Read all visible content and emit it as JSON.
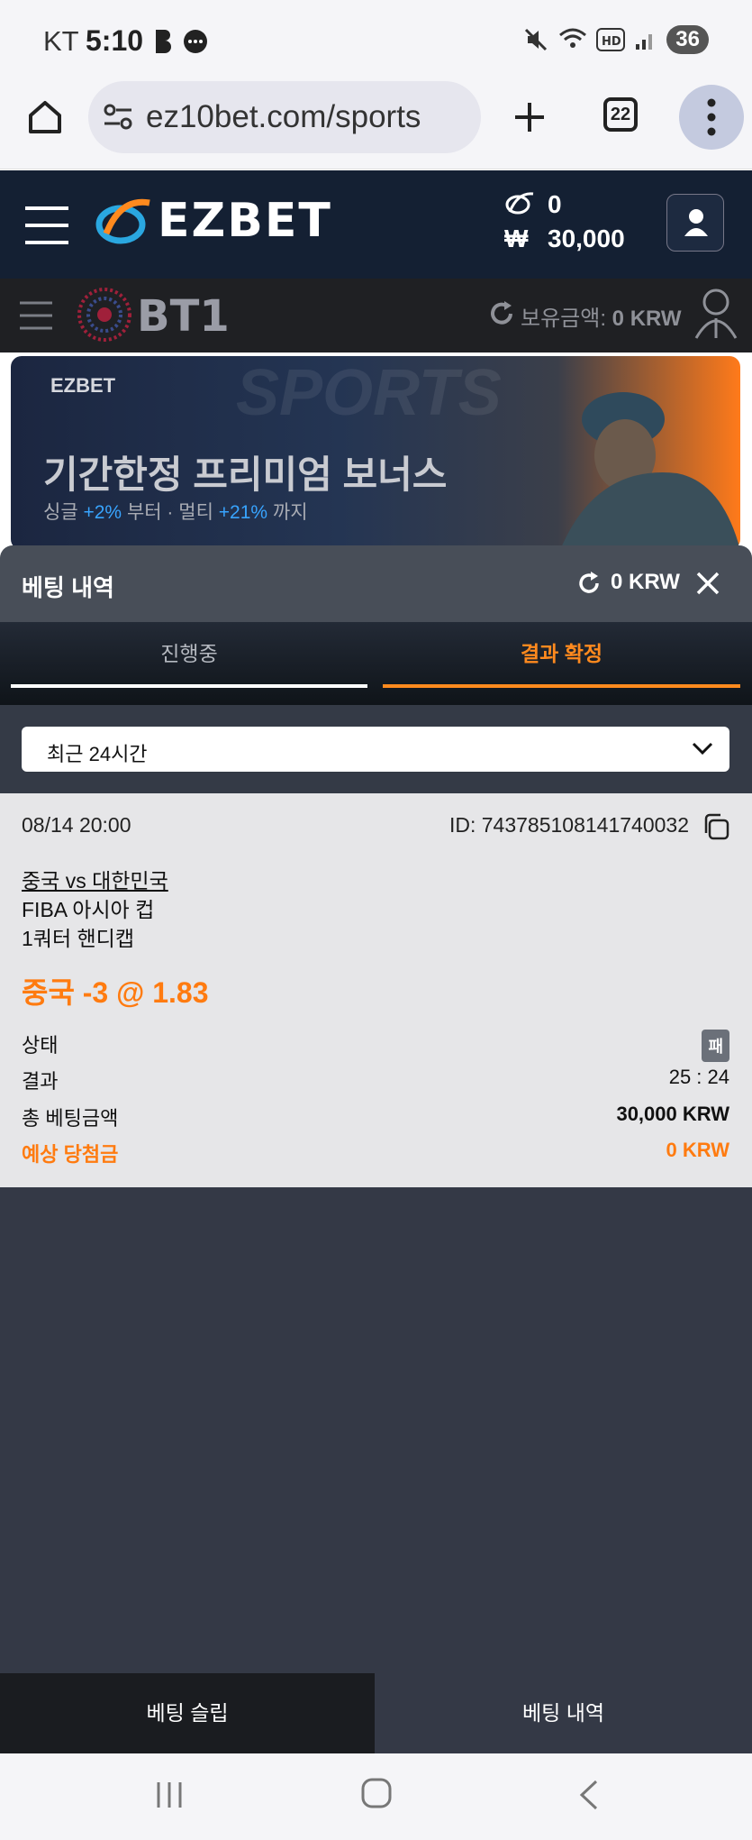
{
  "status_bar": {
    "carrier": "KT",
    "time": "5:10",
    "battery": "36"
  },
  "browser": {
    "url": "ez10bet.com/sports",
    "tab_count": "22"
  },
  "header": {
    "logo": "EZBET",
    "points": "0",
    "currency_symbol": "₩",
    "balance": "30,000"
  },
  "sub_header": {
    "logo": "BT1",
    "balance_label": "보유금액:",
    "balance_value": "0 KRW"
  },
  "banner": {
    "brand": "EZBET",
    "watermark": "SPORTS",
    "title": "기간한정 프리미엄 보너스",
    "sub_single": "싱글",
    "sub_single_pct": "+2%",
    "sub_from": "부터 · 멀티",
    "sub_multi_pct": "+21%",
    "sub_until": "까지"
  },
  "modal": {
    "title": "베팅 내역",
    "balance": "0 KRW",
    "tabs": [
      {
        "label": "진행중",
        "active": false
      },
      {
        "label": "결과 확정",
        "active": true
      }
    ],
    "filter": {
      "selected": "최근 24시간"
    }
  },
  "bet": {
    "datetime": "08/14 20:00",
    "id": "ID: 743785108141740032",
    "match": "중국 vs 대한민국",
    "league": "FIBA 아시아 컵",
    "market": "1쿼터 핸디캡",
    "pick": "중국 -3 @ 1.83",
    "status_label": "상태",
    "status_value": "패",
    "result_label": "결과",
    "result_value": "25 : 24",
    "stake_label": "총 베팅금액",
    "stake_value": "30,000 KRW",
    "payout_label": "예상 당첨금",
    "payout_value": "0 KRW"
  },
  "bottom_tabs": {
    "left": "베팅 슬립",
    "right": "베팅 내역"
  },
  "colors": {
    "accent": "#ff8a1e",
    "header_bg": "#142033",
    "panel_bg": "#343946"
  }
}
